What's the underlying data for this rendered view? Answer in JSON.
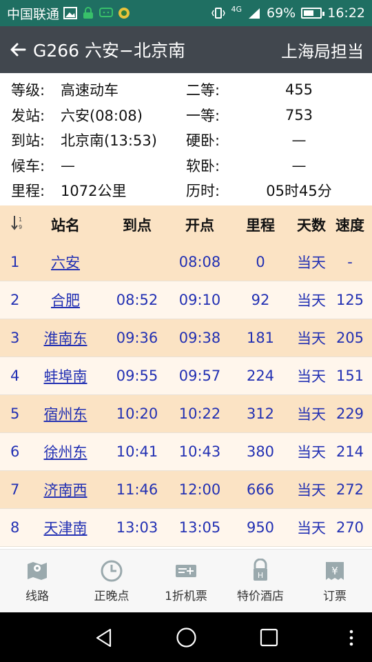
{
  "status_bar": {
    "carrier": "中国联通",
    "network": "4G",
    "battery": "69%",
    "battery_level": 0.69,
    "time": "16:22"
  },
  "header": {
    "title": "G266 六安−北京南",
    "bureau": "上海局担当"
  },
  "info": {
    "rows": [
      {
        "label1": "等级:",
        "value1": "高速动车",
        "label2": "二等:",
        "value2": "455"
      },
      {
        "label1": "发站:",
        "value1": "六安(08:08)",
        "label2": "一等:",
        "value2": "753"
      },
      {
        "label1": "到站:",
        "value1": "北京南(13:53)",
        "label2": "硬卧:",
        "value2": "—"
      },
      {
        "label1": "候车:",
        "value1": "—",
        "label2": "软卧:",
        "value2": "—"
      },
      {
        "label1": "里程:",
        "value1": "1072公里",
        "label2": "历时:",
        "value2": "05时45分"
      }
    ]
  },
  "table": {
    "headers": {
      "station": "站名",
      "arrive": "到点",
      "depart": "开点",
      "distance": "里程",
      "days": "天数",
      "speed": "速度"
    },
    "rows": [
      {
        "no": "1",
        "station": "六安",
        "arrive": "",
        "depart": "08:08",
        "distance": "0",
        "days": "当天",
        "speed": "-"
      },
      {
        "no": "2",
        "station": "合肥",
        "arrive": "08:52",
        "depart": "09:10",
        "distance": "92",
        "days": "当天",
        "speed": "125"
      },
      {
        "no": "3",
        "station": "淮南东",
        "arrive": "09:36",
        "depart": "09:38",
        "distance": "181",
        "days": "当天",
        "speed": "205"
      },
      {
        "no": "4",
        "station": "蚌埠南",
        "arrive": "09:55",
        "depart": "09:57",
        "distance": "224",
        "days": "当天",
        "speed": "151"
      },
      {
        "no": "5",
        "station": "宿州东",
        "arrive": "10:20",
        "depart": "10:22",
        "distance": "312",
        "days": "当天",
        "speed": "229"
      },
      {
        "no": "6",
        "station": "徐州东",
        "arrive": "10:41",
        "depart": "10:43",
        "distance": "380",
        "days": "当天",
        "speed": "214"
      },
      {
        "no": "7",
        "station": "济南西",
        "arrive": "11:46",
        "depart": "12:00",
        "distance": "666",
        "days": "当天",
        "speed": "272"
      },
      {
        "no": "8",
        "station": "天津南",
        "arrive": "13:03",
        "depart": "13:05",
        "distance": "950",
        "days": "当天",
        "speed": "270"
      }
    ]
  },
  "bottom_nav": [
    {
      "label": "线路",
      "icon": "map-route-icon"
    },
    {
      "label": "正晚点",
      "icon": "clock-icon"
    },
    {
      "label": "1折机票",
      "icon": "flight-ticket-icon"
    },
    {
      "label": "特价酒店",
      "icon": "hotel-icon"
    },
    {
      "label": "订票",
      "icon": "ticket-yen-icon"
    }
  ],
  "colors": {
    "status_bar": "#1f6f62",
    "header": "#41474e",
    "row_odd": "#fbe3c4",
    "row_even": "#fff6ec",
    "link": "#2230b3"
  }
}
